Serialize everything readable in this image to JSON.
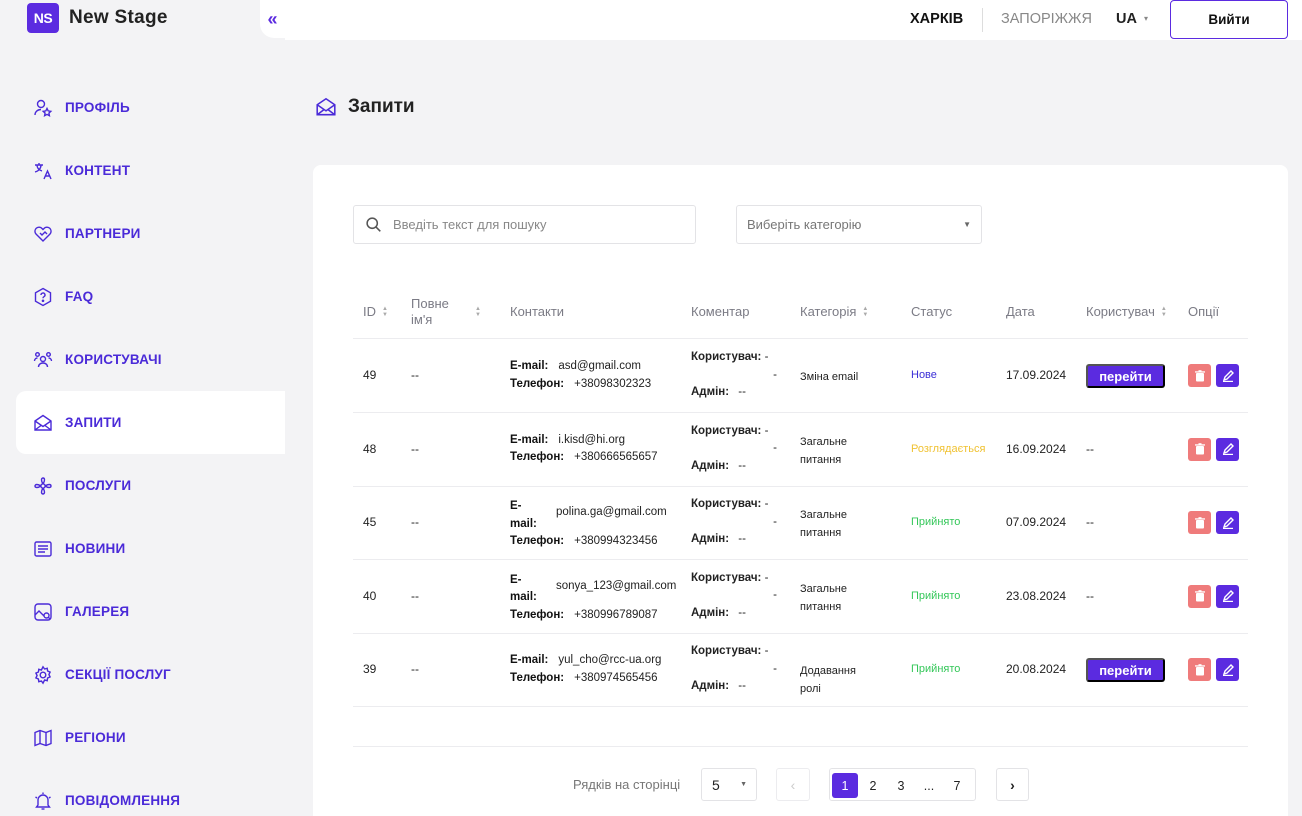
{
  "app": {
    "logo_text": "NS",
    "name": "New Stage",
    "collapse_icon": "«"
  },
  "header": {
    "city_active": "ХАРКІВ",
    "city_inactive": "ЗАПОРІЖЖЯ",
    "lang": "UA",
    "logout_label": "Вийти"
  },
  "sidebar": {
    "items": [
      {
        "label": "ПРОФІЛЬ",
        "icon": "profile-icon"
      },
      {
        "label": "КОНТЕНТ",
        "icon": "translate-icon"
      },
      {
        "label": "ПАРТНЕРИ",
        "icon": "heart-handshake-icon"
      },
      {
        "label": "FAQ",
        "icon": "question-hexagon-icon"
      },
      {
        "label": "КОРИСТУВАЧІ",
        "icon": "users-icon"
      },
      {
        "label": "ЗАПИТИ",
        "icon": "mail-icon"
      },
      {
        "label": "ПОСЛУГИ",
        "icon": "flower-icon"
      },
      {
        "label": "НОВИНИ",
        "icon": "newspaper-icon"
      },
      {
        "label": "ГАЛЕРЕЯ",
        "icon": "gallery-icon"
      },
      {
        "label": "СЕКЦІЇ ПОСЛУГ",
        "icon": "gear-icon"
      },
      {
        "label": "РЕГІОНИ",
        "icon": "map-icon"
      },
      {
        "label": "ПОВІДОМЛЕННЯ",
        "icon": "bell-icon"
      }
    ],
    "active": "ЗАПИТИ"
  },
  "page": {
    "title": "Запити"
  },
  "filters": {
    "search_placeholder": "Введіть текст для пошуку",
    "category_placeholder": "Виберіть категорію"
  },
  "table": {
    "columns": {
      "id": "ID",
      "fullname": "Повне ім'я",
      "contacts": "Контакти",
      "comment": "Коментар",
      "category": "Категорія",
      "status": "Статус",
      "date": "Дата",
      "user": "Користувач",
      "options": "Опції"
    },
    "email_label": "E-mail:",
    "phone_label": "Телефон:",
    "comment_user_label": "Користувач:",
    "comment_admin_label": "Адмін:",
    "go_label": "перейти",
    "rows": [
      {
        "id": "49",
        "name": "--",
        "email": "asd@gmail.com",
        "phone": "+38098302323",
        "cu": "-",
        "cu2": "-",
        "ca": "--",
        "category": "Зміна email",
        "status": "Нове",
        "date": "17.09.2024",
        "user": ""
      },
      {
        "id": "48",
        "name": "--",
        "email": "i.kisd@hi.org",
        "phone": "+380666565657",
        "cu": "-",
        "cu2": "-",
        "ca": "--",
        "category": "Загальне питання",
        "status": "Розглядається",
        "date": "16.09.2024",
        "user": "--"
      },
      {
        "id": "45",
        "name": "--",
        "email": "polina.ga@gmail.com",
        "phone": "+380994323456",
        "cu": "-",
        "cu2": "-",
        "ca": "--",
        "category": "Загальне питання",
        "status": "Прийнято",
        "date": "07.09.2024",
        "user": "--"
      },
      {
        "id": "40",
        "name": "--",
        "email": "sonya_123@gmail.com",
        "phone": "+380996789087",
        "cu": "-",
        "cu2": "-",
        "ca": "--",
        "category": "Загальне питання",
        "status": "Прийнято",
        "date": "23.08.2024",
        "user": "--"
      },
      {
        "id": "39",
        "name": "--",
        "email": "yul_cho@rcc-ua.org",
        "phone": "+380974565456",
        "cu": "-",
        "cu2": "-",
        "ca": "--",
        "category": "Додавання ролі",
        "status": "Прийнято",
        "date": "20.08.2024",
        "user": ""
      }
    ]
  },
  "pagination": {
    "rows_label": "Рядків на сторінці",
    "rows_per_page": "5",
    "pages": [
      "1",
      "2",
      "3",
      "...",
      "7"
    ],
    "current": "1"
  },
  "colors": {
    "accent": "#5b2be0",
    "status_new": "#3b2fd6",
    "status_review": "#f0c232",
    "status_accepted": "#34c759",
    "delete": "#ef7b7b"
  }
}
